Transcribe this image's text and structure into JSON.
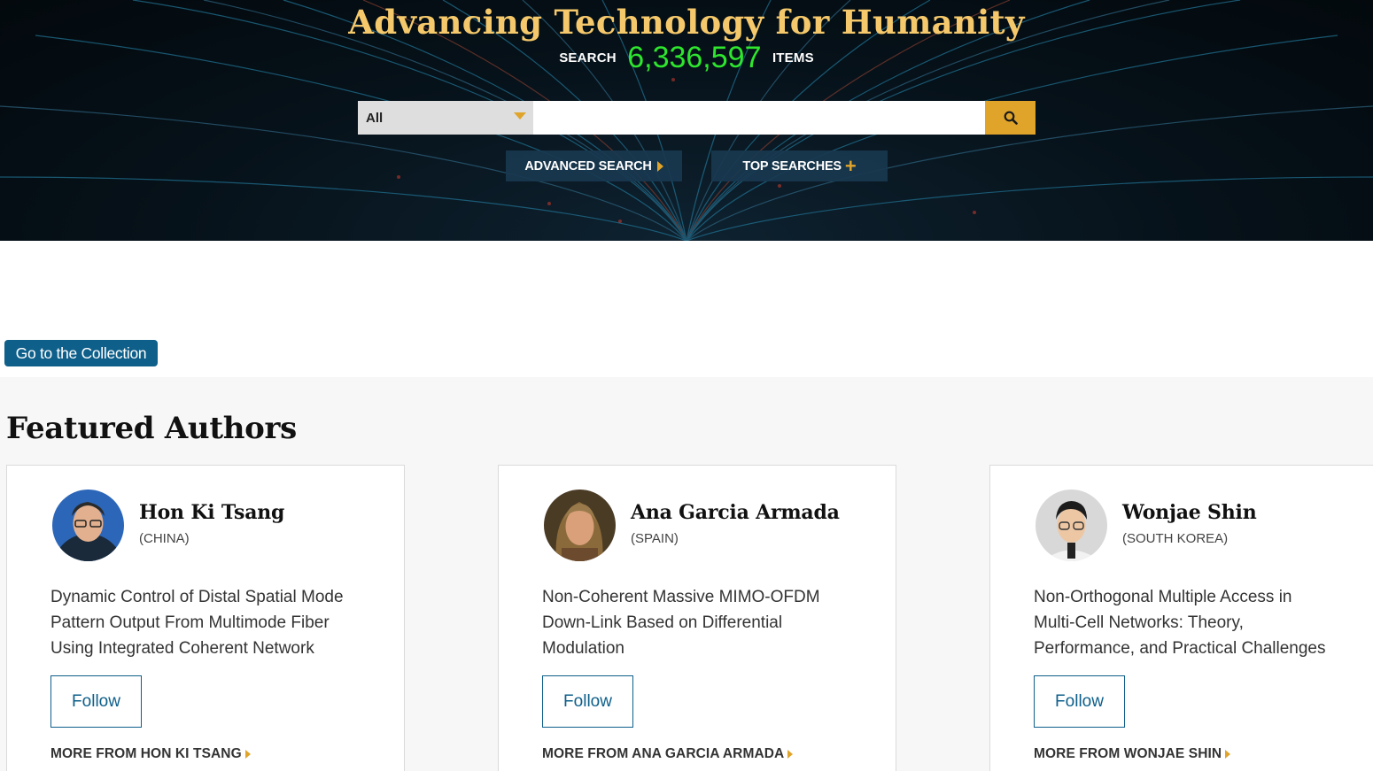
{
  "hero": {
    "title": "Advancing Technology for Humanity",
    "search_prefix": "SEARCH",
    "item_count": "6,336,597",
    "items_suffix": "ITEMS",
    "scope_selected": "All",
    "search_placeholder": "",
    "advanced_search_label": "ADVANCED SEARCH",
    "top_searches_label": "TOP SEARCHES"
  },
  "collection_button_label": "Go to the Collection",
  "featured": {
    "title": "Featured Authors",
    "authors": [
      {
        "name": "Hon Ki Tsang",
        "country": "(CHINA)",
        "paper": "Dynamic Control of Distal Spatial Mode Pattern Output From Multimode Fiber Using Integrated Coherent Network",
        "follow_label": "Follow",
        "more_label": "MORE FROM HON KI TSANG"
      },
      {
        "name": "Ana Garcia Armada",
        "country": "(SPAIN)",
        "paper": "Non-Coherent Massive MIMO-OFDM Down-Link Based on Differential Modulation",
        "follow_label": "Follow",
        "more_label": "MORE FROM ANA GARCIA ARMADA"
      },
      {
        "name": "Wonjae Shin",
        "country": "(SOUTH KOREA)",
        "paper": "Non-Orthogonal Multiple Access in Multi-Cell Networks: Theory, Performance, and Practical Challenges",
        "follow_label": "Follow",
        "more_label": "MORE FROM WONJAE SHIN"
      }
    ]
  },
  "colors": {
    "accent_gold": "#e0a42b",
    "count_green": "#2ee62e",
    "link_blue": "#0e5f8a"
  }
}
